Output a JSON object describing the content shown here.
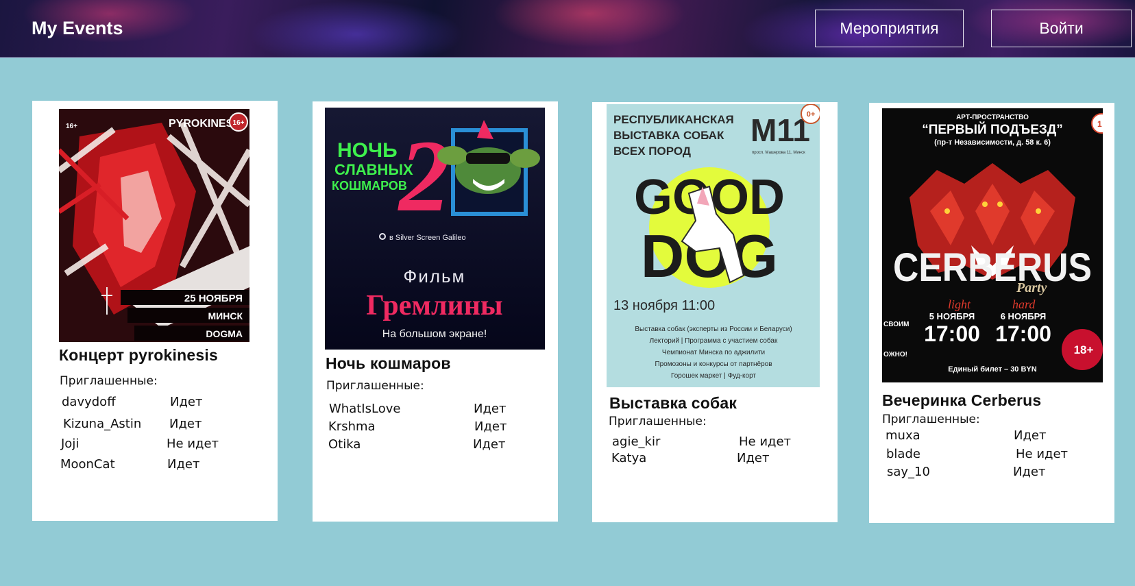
{
  "header": {
    "logo": "My Events",
    "nav_events": "Мероприятия",
    "nav_login": "Войти"
  },
  "invited_label": "Приглашенные:",
  "events": [
    {
      "title": "Концерт pyrokinesis",
      "poster": {
        "artist": "PYROKINESIS",
        "age": "16+",
        "age_small": "16+",
        "date": "25 НОЯБРЯ",
        "city": "МИНСК",
        "venue": "DOGMA"
      },
      "guests": [
        {
          "name": "davydoff",
          "status": "Идет"
        },
        {
          "name": "Kizuna_Astin",
          "status": "Идет"
        },
        {
          "name": "Joji",
          "status": "Не идет"
        },
        {
          "name": "MoonCat",
          "status": "Идет"
        }
      ]
    },
    {
      "title": "Ночь кошмаров",
      "poster": {
        "line1": "НОЧЬ",
        "line2": "СЛАВНЫХ",
        "line3": "КОШМАРОВ",
        "number": "2",
        "location": "в Silver Screen Galileo",
        "film_label": "Фильм",
        "film_title": "Гремлины",
        "subtitle": "На большом экране!"
      },
      "guests": [
        {
          "name": "WhatIsLove",
          "status": "Идет"
        },
        {
          "name": "Krshma",
          "status": "Идет"
        },
        {
          "name": "Otika",
          "status": "Идет"
        }
      ]
    },
    {
      "title": "Выставка собак",
      "poster": {
        "heading1": "РЕСПУБЛИКАНСКАЯ",
        "heading2": "ВЫСТАВКА СОБАК",
        "heading3": "ВСЕХ ПОРОД",
        "venue": "M11",
        "address": "просп. Машерова 11, Минск",
        "age": "0+",
        "good": "GOOD",
        "dog": "DOG",
        "datetime": "13 ноября 11:00",
        "info1": "Выставка собак (эксперты из России и Беларуси)",
        "info2": "Лекторий   |   Программа с участием собак",
        "info3": "Чемпионат Минска по аджилити",
        "info4": "Промозоны и конкурсы от партнёров",
        "info5": "Горошек маркет   |   Фуд-корт"
      },
      "guests": [
        {
          "name": "agie_kir",
          "status": "Не идет"
        },
        {
          "name": "Katya",
          "status": "Идет"
        }
      ]
    },
    {
      "title": "Вечеринка Cerberus",
      "poster": {
        "top1": "АРТ-ПРОСТРАНСТВО",
        "top2": "“ПЕРВЫЙ ПОДЪЕЗД”",
        "top3": "(пр-т Независимости, д. 58 к. 6)",
        "name": "CERBERUS",
        "party": "Party",
        "light": "light",
        "hard": "hard",
        "date1": "5 НОЯБРЯ",
        "date2": "6 НОЯБРЯ",
        "time1": "17:00",
        "time2": "17:00",
        "age": "18+",
        "side": "СВОИМ",
        "side2": "ОЖНО!",
        "ticket": "Единый билет – 30 BYN",
        "corner": "1"
      },
      "guests": [
        {
          "name": "muxa",
          "status": "Идет"
        },
        {
          "name": "blade",
          "status": "Не идет"
        },
        {
          "name": "say_10",
          "status": "Идет"
        }
      ]
    }
  ]
}
